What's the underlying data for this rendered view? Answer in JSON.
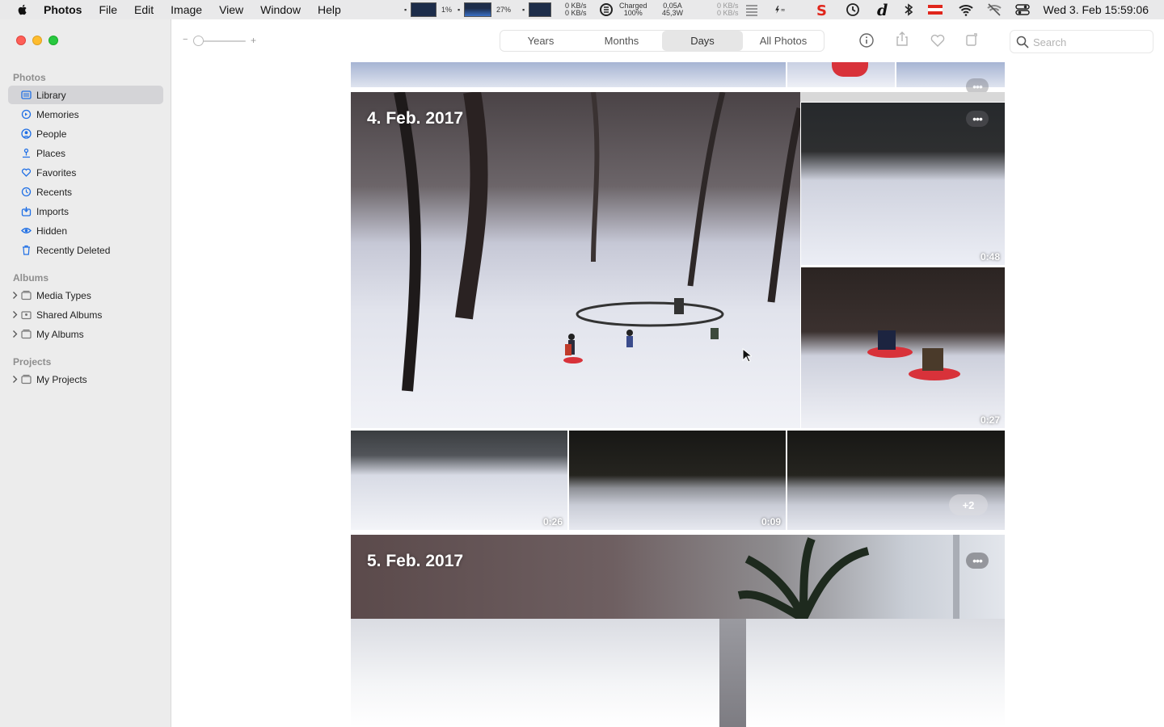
{
  "menubar": {
    "app_name": "Photos",
    "menus": [
      "File",
      "Edit",
      "Image",
      "View",
      "Window",
      "Help"
    ],
    "cpu_percent": "1%",
    "gpu_percent": "27%",
    "net_down_top": "0 KB/s",
    "net_down_bottom": "0 KB/s",
    "battery_status": "Charged",
    "battery_percent": "100%",
    "power_current": "0,05A",
    "power_watts": "45,3W",
    "net2_top": "0 KB/s",
    "net2_bottom": "0 KB/s",
    "clock": "Wed 3. Feb  15:59:06"
  },
  "sidebar": {
    "photos_header": "Photos",
    "items": [
      {
        "label": "Library",
        "icon": "library-icon"
      },
      {
        "label": "Memories",
        "icon": "memories-icon"
      },
      {
        "label": "People",
        "icon": "people-icon"
      },
      {
        "label": "Places",
        "icon": "places-icon"
      },
      {
        "label": "Favorites",
        "icon": "heart-icon"
      },
      {
        "label": "Recents",
        "icon": "clock-icon"
      },
      {
        "label": "Imports",
        "icon": "import-icon"
      },
      {
        "label": "Hidden",
        "icon": "eye-icon"
      },
      {
        "label": "Recently Deleted",
        "icon": "trash-icon"
      }
    ],
    "albums_header": "Albums",
    "albums": [
      {
        "label": "Media Types"
      },
      {
        "label": "Shared Albums"
      },
      {
        "label": "My Albums"
      }
    ],
    "projects_header": "Projects",
    "projects": [
      {
        "label": "My Projects"
      }
    ]
  },
  "toolbar": {
    "zoom_minus": "−",
    "zoom_plus": "+",
    "tabs": [
      "Years",
      "Months",
      "Days",
      "All Photos"
    ],
    "selected_tab": "Days",
    "search_placeholder": "Search"
  },
  "grid": {
    "day1_title": "4. Feb. 2017",
    "day2_title": "5. Feb. 2017",
    "durations": [
      "0:48",
      "0:27",
      "0:26",
      "0:09"
    ],
    "more_count": "+2"
  }
}
